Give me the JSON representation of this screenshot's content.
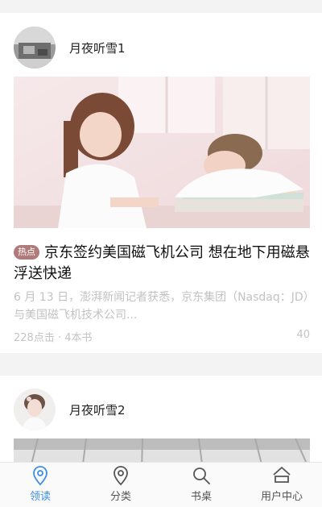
{
  "feed": {
    "cards": [
      {
        "author": "月夜听雪1",
        "badge": "热点",
        "title": "京东签约美国磁飞机公司 想在地下用磁悬浮送快递",
        "summary": "6 月 13 日，澎湃新闻记者获悉，京东集团（Nasdaq：JD）与美国磁飞机技术公司...",
        "stats": "228点击 · 4本书",
        "count": "40"
      },
      {
        "author": "月夜听雪2"
      }
    ]
  },
  "tabbar": {
    "active_color": "#3a8ee6",
    "items": [
      {
        "label": "领读",
        "icon": "location-pin-icon",
        "active": true
      },
      {
        "label": "分类",
        "icon": "location-pin-icon",
        "active": false
      },
      {
        "label": "书桌",
        "icon": "search-icon",
        "active": false
      },
      {
        "label": "用户中心",
        "icon": "home-icon",
        "active": false
      }
    ]
  }
}
